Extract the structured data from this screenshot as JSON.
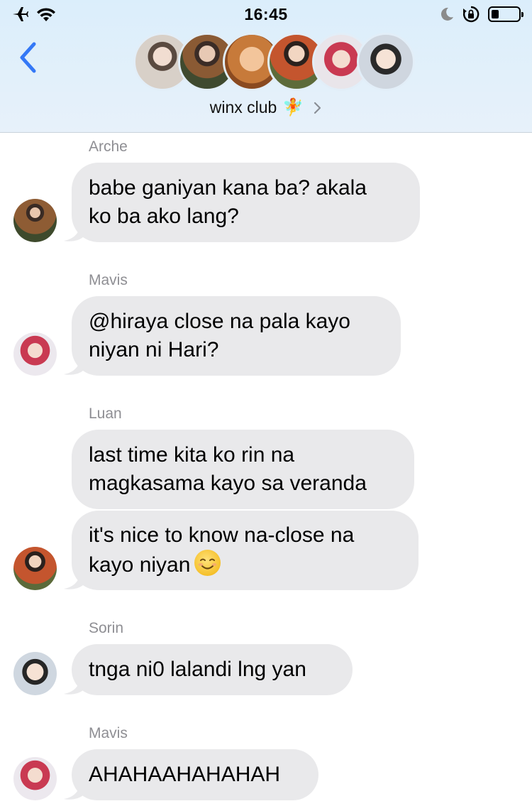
{
  "status_bar": {
    "time": "16:45",
    "left_icons": [
      "airplane-icon",
      "wifi-icon"
    ],
    "right_icons": [
      "moon-icon",
      "orientation-lock-icon",
      "battery-icon"
    ],
    "battery_level": 0.25
  },
  "header": {
    "group_name": "winx club",
    "group_emoji": "🧚",
    "member_avatar_count": 6
  },
  "messages": [
    {
      "sender": "Arche",
      "bubbles": [
        "babe ganiyan kana ba? akala\nko ba ako lang?"
      ]
    },
    {
      "sender": "Mavis",
      "bubbles": [
        "@hiraya close na pala kayo\nniyan ni Hari?"
      ]
    },
    {
      "sender": "Luan",
      "bubbles": [
        "last time kita ko rin na\nmagkasama kayo sa veranda",
        "it's nice to know na-close na\nkayo niyan"
      ]
    },
    {
      "sender": "Sorin",
      "bubbles": [
        "tnga ni0 lalandi lng yan"
      ]
    },
    {
      "sender": "Mavis",
      "bubbles": [
        "AHAHAAHAHAHAH"
      ]
    }
  ],
  "colors": {
    "accent": "#3478f6",
    "bubble": "#e9e9eb",
    "sender_label": "#8e8e93",
    "header_bg": "#dbeefb"
  }
}
